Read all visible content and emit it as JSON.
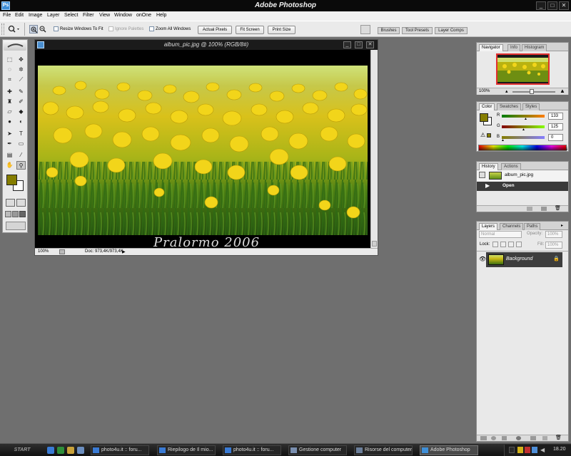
{
  "window": {
    "title": "Adobe Photoshop",
    "icon": "ps-logo-icon",
    "controls": [
      "minimize-icon",
      "maximize-icon",
      "close-icon"
    ]
  },
  "menu": [
    "File",
    "Edit",
    "Image",
    "Layer",
    "Select",
    "Filter",
    "View",
    "Window",
    "onOne",
    "Help"
  ],
  "options": {
    "resize_windows": "Resize Windows To Fit",
    "ignore_palettes": "Ignore Palettes",
    "zoom_all_windows": "Zoom All Windows",
    "actual_pixels": "Actual Pixels",
    "fit_screen": "Fit Screen",
    "print_size": "Print Size",
    "well_tabs": [
      "Brushes",
      "Tool Presets",
      "Layer Comps"
    ]
  },
  "document": {
    "title": "album_pic.jpg @ 100% (RGB/8#)",
    "watermark": "Pralormo 2006",
    "zoom": "100%",
    "doc_size": "Doc: 973,4K/973,4K"
  },
  "navigator": {
    "tabs": [
      "Navigator",
      "Info",
      "Histogram"
    ],
    "zoom": "100%"
  },
  "color": {
    "tabs": [
      "Color",
      "Swatches",
      "Styles"
    ],
    "r_label": "R",
    "g_label": "G",
    "b_label": "B",
    "r": "133",
    "g": "125",
    "b": "0",
    "foreground": "#857d00"
  },
  "history": {
    "tabs": [
      "History",
      "Actions"
    ],
    "snapshot": "album_pic.jpg",
    "step": "Open"
  },
  "layers": {
    "tabs": [
      "Layers",
      "Channels",
      "Paths"
    ],
    "blend_mode": "Normal",
    "opacity_label": "Opacity:",
    "opacity": "100%",
    "lock_label": "Lock:",
    "fill_label": "Fill:",
    "fill": "100%",
    "layer_name": "Background"
  },
  "taskbar": {
    "start": "START",
    "tasks": [
      "photo4u.it :: foru...",
      "Riepilogo de Il mio...",
      "photo4u.it :: foru...",
      "Gestione computer",
      "Risorse del computer",
      "Adobe Photoshop"
    ],
    "clock": "18.20"
  }
}
